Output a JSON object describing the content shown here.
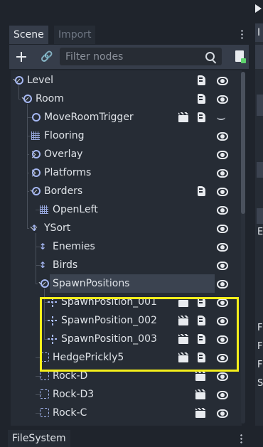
{
  "scene_dock": {
    "tabs": [
      {
        "label": "Scene",
        "active": true
      },
      {
        "label": "Import",
        "active": false
      }
    ],
    "toolbar": {
      "add_icon": "plus-icon",
      "link_icon": "link-icon",
      "filter_placeholder": "Filter nodes",
      "search_icon": "search-icon",
      "instance_icon": "instance-child-scene-icon"
    },
    "tree": [
      {
        "label": "Level",
        "icon": "node-circle",
        "script": true,
        "visible": true
      },
      {
        "label": "Room",
        "icon": "node-circle",
        "script": true,
        "visible": true
      },
      {
        "label": "MoveRoomTrigger",
        "icon": "node-circle",
        "scene": true,
        "script": true,
        "visible": false
      },
      {
        "label": "Flooring",
        "icon": "tilemap",
        "visible": true
      },
      {
        "label": "Overlay",
        "icon": "node-circle",
        "visible": true
      },
      {
        "label": "Platforms",
        "icon": "node-circle",
        "visible": true
      },
      {
        "label": "Borders",
        "icon": "node-circle",
        "script": true,
        "visible": true
      },
      {
        "label": "OpenLeft",
        "icon": "tilemap",
        "visible": true
      },
      {
        "label": "YSort",
        "icon": "ysort",
        "visible": true
      },
      {
        "label": "Enemies",
        "icon": "ysort",
        "visible": true
      },
      {
        "label": "Birds",
        "icon": "ysort",
        "visible": true
      },
      {
        "label": "SpawnPositions",
        "icon": "node-circle",
        "selected": true,
        "visible": true
      },
      {
        "label": "SpawnPosition_001",
        "icon": "position2d",
        "scene": true,
        "script": true,
        "visible": true
      },
      {
        "label": "SpawnPosition_002",
        "icon": "position2d",
        "scene": true,
        "script": true,
        "visible": true
      },
      {
        "label": "SpawnPosition_003",
        "icon": "position2d",
        "scene": true,
        "script": true,
        "visible": true
      },
      {
        "label": "HedgePrickly5",
        "icon": "rect",
        "scene": true,
        "script": true,
        "visible": true
      },
      {
        "label": "Rock-D",
        "icon": "rect",
        "scene": true,
        "visible": true
      },
      {
        "label": "Rock-D3",
        "icon": "rect",
        "scene": true,
        "visible": true
      },
      {
        "label": "Rock-C",
        "icon": "rect",
        "scene": true,
        "visible": true
      }
    ]
  },
  "right_panel": {
    "tab_initial": "I",
    "labels": [
      "E",
      "F",
      "F",
      "F",
      "S"
    ]
  },
  "filesystem_dock": {
    "tab": "FileSystem"
  },
  "highlight_color": "#f5ef1b"
}
